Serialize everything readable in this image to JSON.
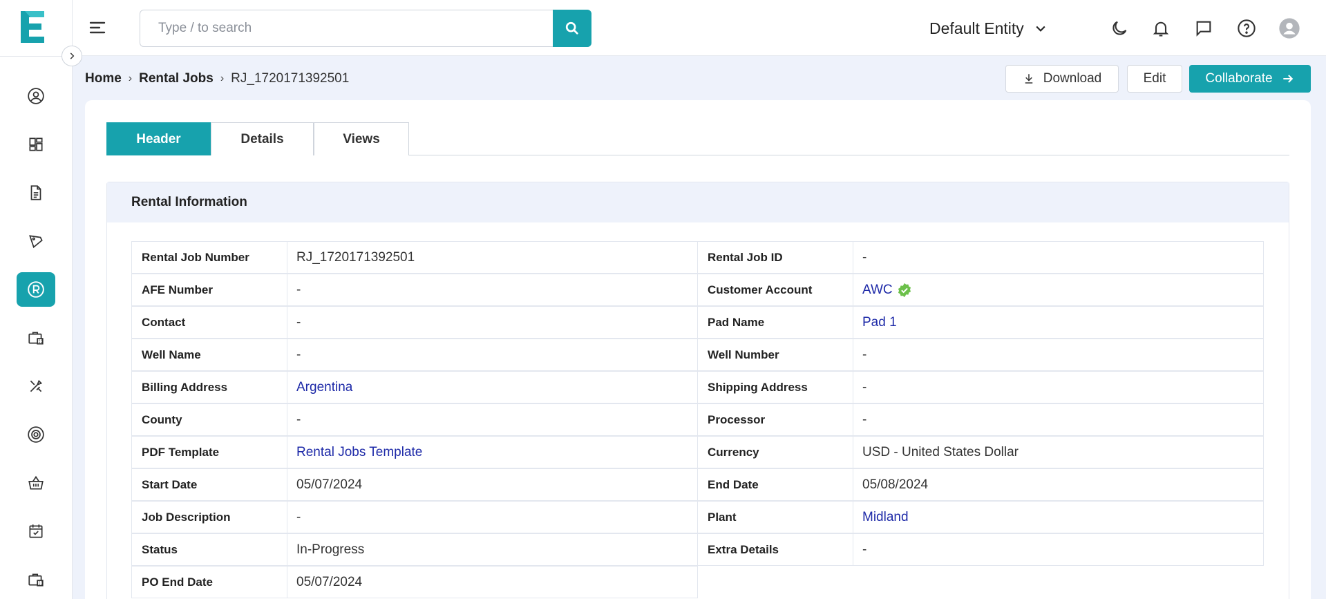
{
  "search": {
    "placeholder": "Type / to search"
  },
  "entity": {
    "label": "Default Entity"
  },
  "breadcrumb": {
    "home": "Home",
    "section": "Rental Jobs",
    "current": "RJ_1720171392501"
  },
  "actions": {
    "download": "Download",
    "edit": "Edit",
    "collaborate": "Collaborate"
  },
  "tabs": [
    {
      "label": "Header"
    },
    {
      "label": "Details"
    },
    {
      "label": "Views"
    }
  ],
  "section": {
    "title": "Rental Information"
  },
  "left_fields": [
    {
      "label": "Rental Job Number",
      "value": "RJ_1720171392501"
    },
    {
      "label": "AFE Number",
      "value": "-"
    },
    {
      "label": "Contact",
      "value": "-"
    },
    {
      "label": "Well Name",
      "value": "-"
    },
    {
      "label": "Billing Address",
      "value": "Argentina"
    },
    {
      "label": "County",
      "value": "-"
    },
    {
      "label": "PDF Template",
      "value": "Rental Jobs Template"
    },
    {
      "label": "Start Date",
      "value": "05/07/2024"
    },
    {
      "label": "Job Description",
      "value": "-"
    },
    {
      "label": "Status",
      "value": "In-Progress"
    },
    {
      "label": "PO End Date",
      "value": "05/07/2024"
    }
  ],
  "right_fields": [
    {
      "label": "Rental Job ID",
      "value": "-"
    },
    {
      "label": "Customer Account",
      "value": "AWC"
    },
    {
      "label": "Pad Name",
      "value": "Pad 1"
    },
    {
      "label": "Well Number",
      "value": "-"
    },
    {
      "label": "Shipping Address",
      "value": "-"
    },
    {
      "label": "Processor",
      "value": "-"
    },
    {
      "label": "Currency",
      "value": "USD - United States Dollar"
    },
    {
      "label": "End Date",
      "value": "05/08/2024"
    },
    {
      "label": "Plant",
      "value": "Midland"
    },
    {
      "label": "Extra Details",
      "value": "-"
    }
  ],
  "colors": {
    "accent": "#17a2ad",
    "link": "#1e2aa8",
    "verified": "#6cc04a",
    "background": "#eef2fb"
  }
}
